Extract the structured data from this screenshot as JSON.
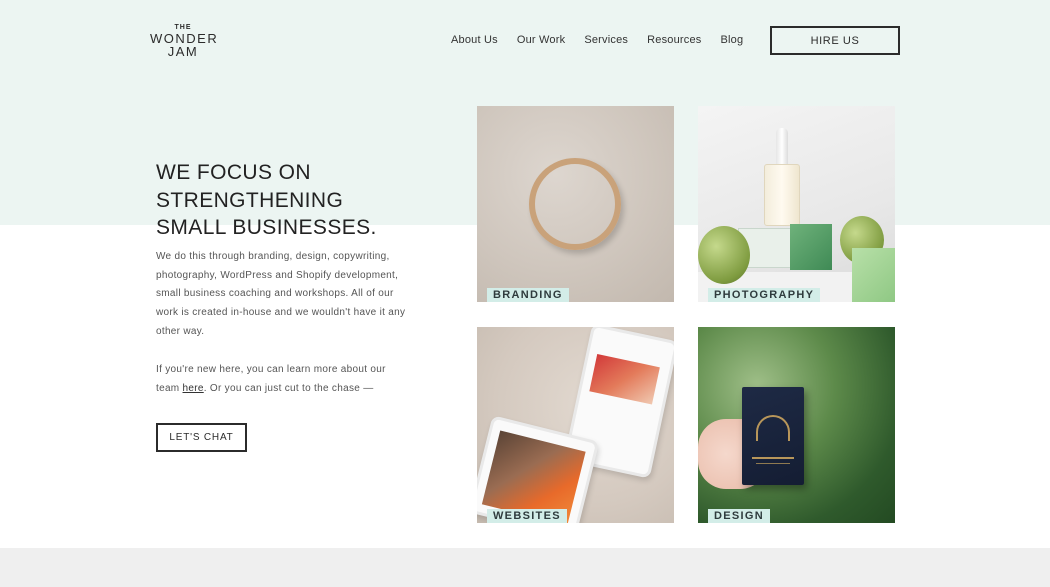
{
  "brand": {
    "logo_top": "THE",
    "logo_line1": "WONDER",
    "logo_line2": "JAM"
  },
  "nav": {
    "items": [
      "About Us",
      "Our Work",
      "Services",
      "Resources",
      "Blog"
    ],
    "cta": "HIRE US"
  },
  "hero": {
    "headline_lines": [
      "WE FOCUS ON",
      "STRENGTHENING",
      "SMALL BUSINESSES."
    ],
    "paragraph1": "We do this through branding, design, copywriting, photography, WordPress and Shopify development, small business coaching and workshops. All of our work is created in-house and we wouldn't have it any other way.",
    "paragraph2_before": "If you're new here, you can learn more about our team ",
    "paragraph2_link": "here",
    "paragraph2_after": ". Or you can just cut to the chase —",
    "chat_button": "LET'S CHAT"
  },
  "tiles": [
    {
      "label": "BRANDING"
    },
    {
      "label": "PHOTOGRAPHY"
    },
    {
      "label": "WEBSITES"
    },
    {
      "label": "DESIGN"
    }
  ],
  "colors": {
    "mint_band": "#ecf5f2",
    "label_bg": "#d3ede8",
    "footer_band": "#efefef",
    "text_dark": "#2b2b2b"
  }
}
